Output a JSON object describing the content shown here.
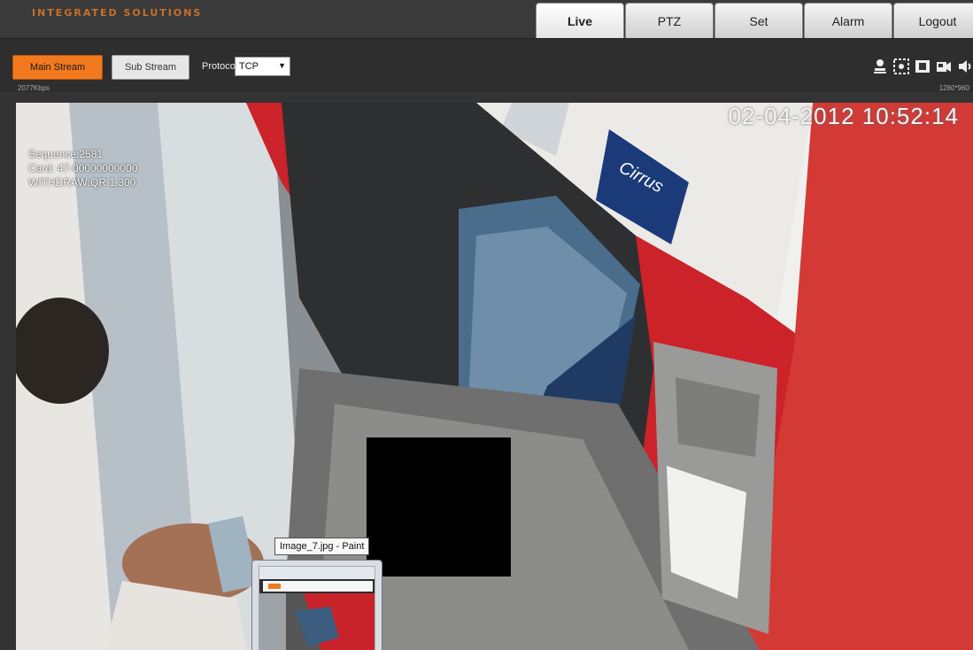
{
  "header": {
    "brand": "INTEGRATED SOLUTIONS",
    "tabs": [
      {
        "label": "Live"
      },
      {
        "label": "PTZ"
      },
      {
        "label": "Set"
      },
      {
        "label": "Alarm"
      },
      {
        "label": "Logout"
      }
    ]
  },
  "toolbar": {
    "main_stream": "Main Stream",
    "sub_stream": "Sub Stream",
    "protocol_label": "Protocol",
    "protocol_value": "TCP",
    "resolution_left": "2077Kbps",
    "resolution_right": "1280*960",
    "icons": [
      "person-icon",
      "record-icon",
      "snapshot-icon",
      "camera-icon",
      "audio-icon"
    ]
  },
  "video": {
    "overlay_lines": [
      "Sequence:2581",
      "Card: 47-00000000000",
      "WITHDRAW:QR 1,300"
    ],
    "timestamp": "02-04-2012 10:52:14",
    "taskbar_preview_title": "Image_7.jpg - Paint"
  },
  "colors": {
    "accent": "#f2791e",
    "brand": "#c8702a",
    "atm_red": "#d0222a"
  }
}
